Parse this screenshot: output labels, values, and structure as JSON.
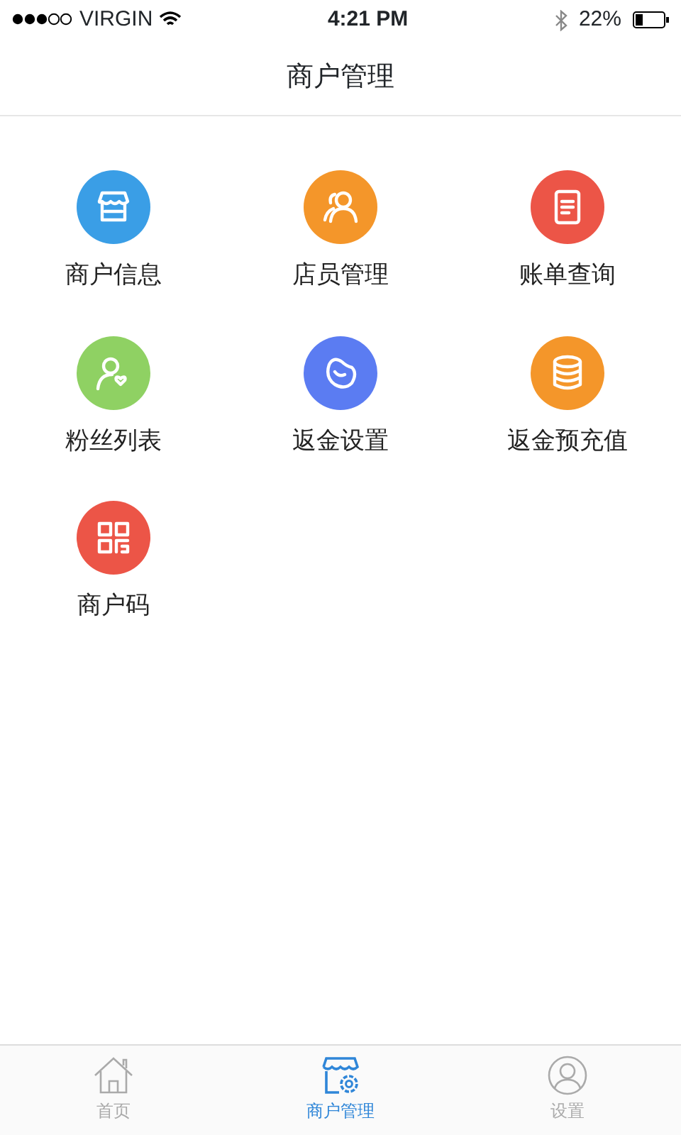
{
  "status_bar": {
    "carrier": "VIRGIN",
    "time": "4:21 PM",
    "battery": "22%"
  },
  "header": {
    "title": "商户管理"
  },
  "grid": [
    {
      "label": "商户信息",
      "color": "#3a9ee6",
      "kind": "store"
    },
    {
      "label": "店员管理",
      "color": "#f4962a",
      "kind": "people"
    },
    {
      "label": "账单查询",
      "color": "#ec5547",
      "kind": "document"
    },
    {
      "label": "粉丝列表",
      "color": "#8fd163",
      "kind": "fan"
    },
    {
      "label": "返金设置",
      "color": "#5b7cf2",
      "kind": "bean"
    },
    {
      "label": "返金预充值",
      "color": "#f4962a",
      "kind": "database"
    },
    {
      "label": "商户码",
      "color": "#ec5547",
      "kind": "qr"
    }
  ],
  "tab_bar": [
    {
      "label": "首页",
      "selected": false,
      "kind": "home"
    },
    {
      "label": "商户管理",
      "selected": true,
      "kind": "store-gear"
    },
    {
      "label": "设置",
      "selected": false,
      "kind": "user"
    }
  ]
}
